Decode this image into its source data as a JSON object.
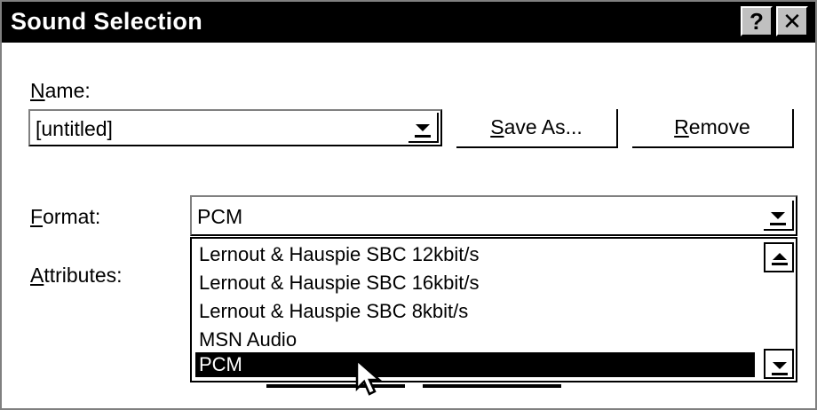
{
  "window": {
    "title": "Sound Selection",
    "help_glyph": "?",
    "close_glyph": "✕"
  },
  "name": {
    "label": "Name:",
    "accel": "N",
    "rest": "ame:",
    "value": "[untitled]"
  },
  "buttons": {
    "save_as": {
      "accel": "S",
      "rest": "ave As..."
    },
    "remove": {
      "accel": "R",
      "rest": "emove"
    }
  },
  "format": {
    "label": "Format:",
    "accel": "F",
    "rest": "ormat:",
    "value": "PCM",
    "options": [
      "Lernout & Hauspie SBC 12kbit/s",
      "Lernout & Hauspie SBC 16kbit/s",
      "Lernout & Hauspie SBC 8kbit/s",
      "MSN Audio",
      "PCM"
    ],
    "selected_index": 4
  },
  "attributes": {
    "label": "Attributes:",
    "accel": "A",
    "rest": "ttributes:"
  }
}
